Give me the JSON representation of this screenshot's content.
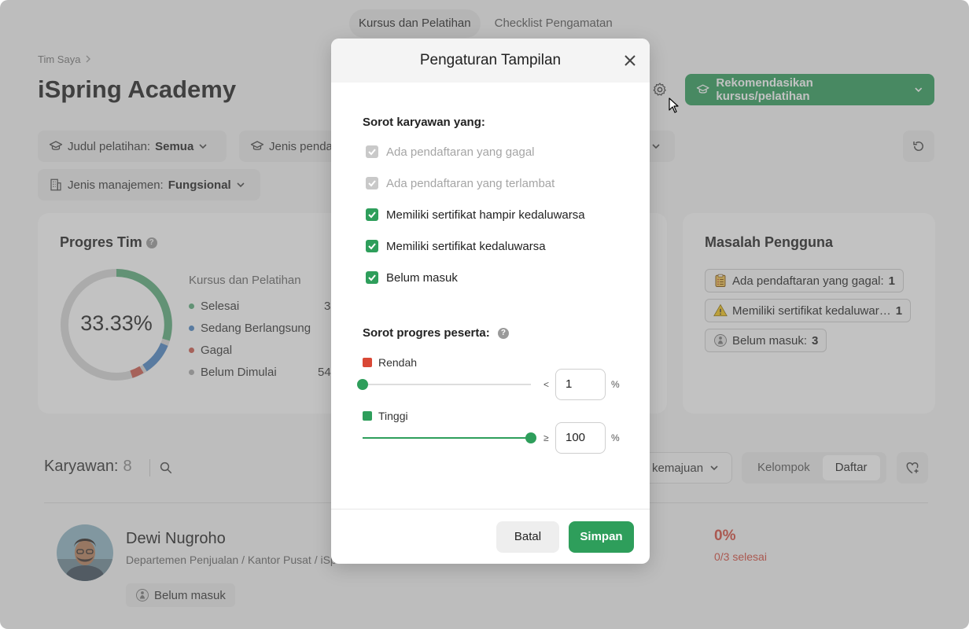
{
  "top_tabs": [
    {
      "label": "Kursus dan Pelatihan",
      "active": true
    },
    {
      "label": "Checklist Pengamatan",
      "active": false
    }
  ],
  "breadcrumb": {
    "item": "Tim Saya"
  },
  "page": {
    "title": "iSpring Academy"
  },
  "header": {
    "recommend_label": "Rekomendasikan kursus/pelatihan"
  },
  "filters": {
    "training_title": {
      "label": "Judul pelatihan:",
      "value": "Semua"
    },
    "enrollment_type": {
      "label": "Jenis penda"
    },
    "management_type": {
      "label": "Jenis manajemen:",
      "value": "Fungsional"
    }
  },
  "team_progress": {
    "title": "Progres Tim",
    "percent": "33.33%",
    "legend_heading": "Kursus dan Pelatihan",
    "legend": [
      {
        "label": "Selesai",
        "value": "3",
        "color": "#5aac7a"
      },
      {
        "label": "Sedang Berlangsung",
        "value": "",
        "color": "#4a86c5"
      },
      {
        "label": "Gagal",
        "value": "",
        "color": "#cf5a4d"
      },
      {
        "label": "Belum Dimulai",
        "value": "54",
        "color": "#a9a9a9"
      }
    ]
  },
  "user_issues": {
    "title": "Masalah Pengguna",
    "items": [
      {
        "label": "Ada pendaftaran yang gagal:",
        "count": "1"
      },
      {
        "label": "Memiliki sertifikat kedaluwar…",
        "count": "1"
      },
      {
        "label": "Belum masuk:",
        "count": "3"
      }
    ]
  },
  "employees": {
    "label": "Karyawan:",
    "count": "8",
    "sort_label": "kemajuan",
    "view_group": "Kelompok",
    "view_list": "Daftar"
  },
  "employee_row": {
    "name": "Dewi Nugroho",
    "path": "Departemen Penjualan / Kantor Pusat / iSp",
    "badge": "Belum masuk",
    "percent": "0%",
    "done": "0/3 selesai"
  },
  "modal": {
    "title": "Pengaturan Tampilan",
    "highlight_title": "Sorot karyawan yang:",
    "options": [
      {
        "label": "Ada pendaftaran yang gagal",
        "checked": true,
        "disabled": true
      },
      {
        "label": "Ada pendaftaran yang terlambat",
        "checked": true,
        "disabled": true
      },
      {
        "label": "Memiliki sertifikat hampir kedaluwarsa",
        "checked": true,
        "disabled": false
      },
      {
        "label": "Memiliki sertifikat kedaluwarsa",
        "checked": true,
        "disabled": false
      },
      {
        "label": "Belum masuk",
        "checked": true,
        "disabled": false
      }
    ],
    "progress_title": "Sorot progres peserta:",
    "low": {
      "label": "Rendah",
      "comparator": "<",
      "value": "1",
      "unit": "%",
      "color": "#d94836",
      "slider_fraction": 0.0
    },
    "high": {
      "label": "Tinggi",
      "comparator": "≥",
      "value": "100",
      "unit": "%",
      "color": "#2e9e5b",
      "slider_fraction": 1.0
    },
    "cancel_label": "Batal",
    "save_label": "Simpan"
  }
}
